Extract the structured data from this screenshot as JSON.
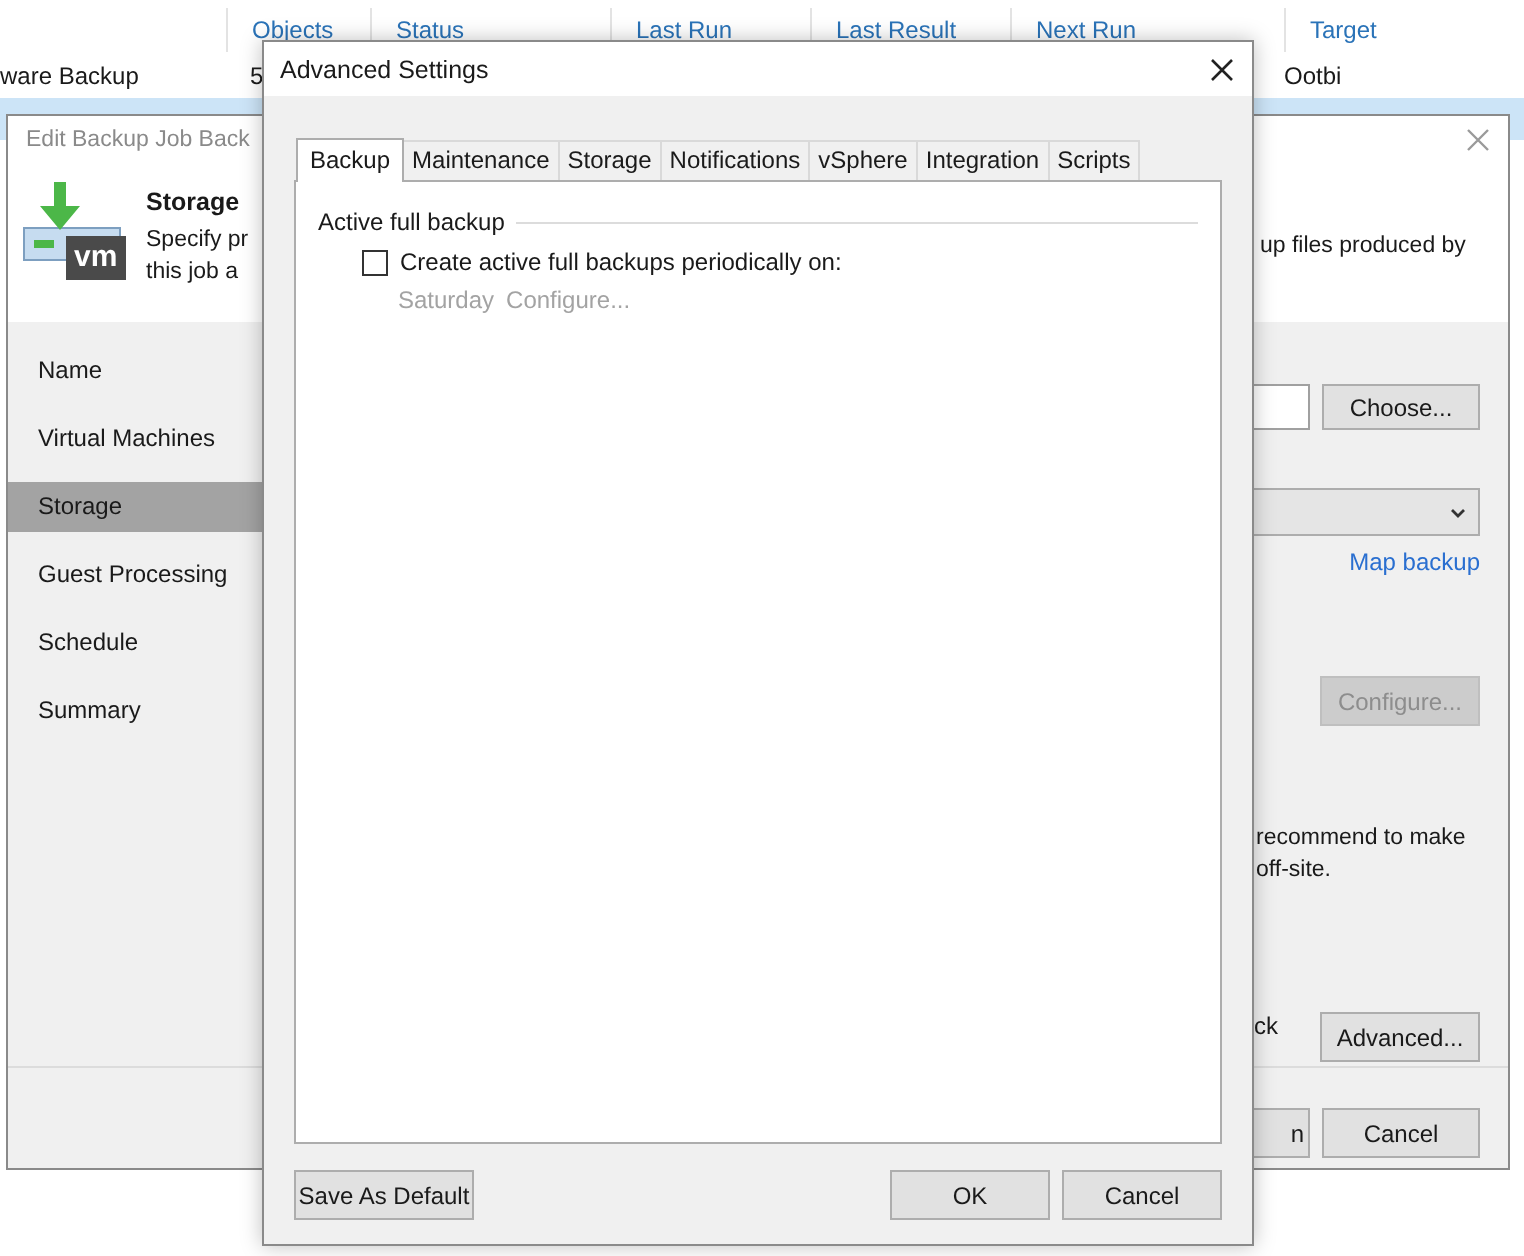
{
  "background_app": {
    "columns": [
      "Objects",
      "Status",
      "Last Run",
      "Last Result",
      "Next Run",
      "Target"
    ],
    "rows": [
      {
        "name": "ware Backup",
        "objects": "5",
        "target": "Ootbi",
        "selected": false
      },
      {
        "selected": true
      }
    ]
  },
  "edit_window": {
    "title": "Edit Backup Job Back",
    "header": {
      "badge": "vm",
      "title": "Storage",
      "description_left": [
        "Specify pr",
        "this job a"
      ],
      "description_right": "up files produced by"
    },
    "steps": [
      {
        "label": "Name",
        "selected": false
      },
      {
        "label": "Virtual Machines",
        "selected": false
      },
      {
        "label": "Storage",
        "selected": true
      },
      {
        "label": "Guest Processing",
        "selected": false
      },
      {
        "label": "Schedule",
        "selected": false
      },
      {
        "label": "Summary",
        "selected": false
      }
    ],
    "choose_button": "Choose...",
    "map_link": "Map backup",
    "configure_button": {
      "label": "Configure...",
      "disabled": true
    },
    "note_lines": [
      "recommend to make",
      "off-site."
    ],
    "option_fragment": "ck",
    "advanced_button": "Advanced...",
    "footer_buttons": [
      "n",
      "Cancel"
    ]
  },
  "dialog": {
    "title": "Advanced Settings",
    "tabs": [
      {
        "label": "Backup",
        "selected": true
      },
      {
        "label": "Maintenance",
        "selected": false
      },
      {
        "label": "Storage",
        "selected": false
      },
      {
        "label": "Notifications",
        "selected": false
      },
      {
        "label": "vSphere",
        "selected": false
      },
      {
        "label": "Integration",
        "selected": false
      },
      {
        "label": "Scripts",
        "selected": false
      }
    ],
    "group_title": "Active full backup",
    "checkbox": {
      "label": "Create active full backups periodically on:",
      "checked": false
    },
    "schedule": {
      "day": "Saturday",
      "link": "Configure...",
      "disabled": true
    },
    "left_button": "Save As Default",
    "right_buttons": [
      "OK",
      "Cancel"
    ]
  }
}
